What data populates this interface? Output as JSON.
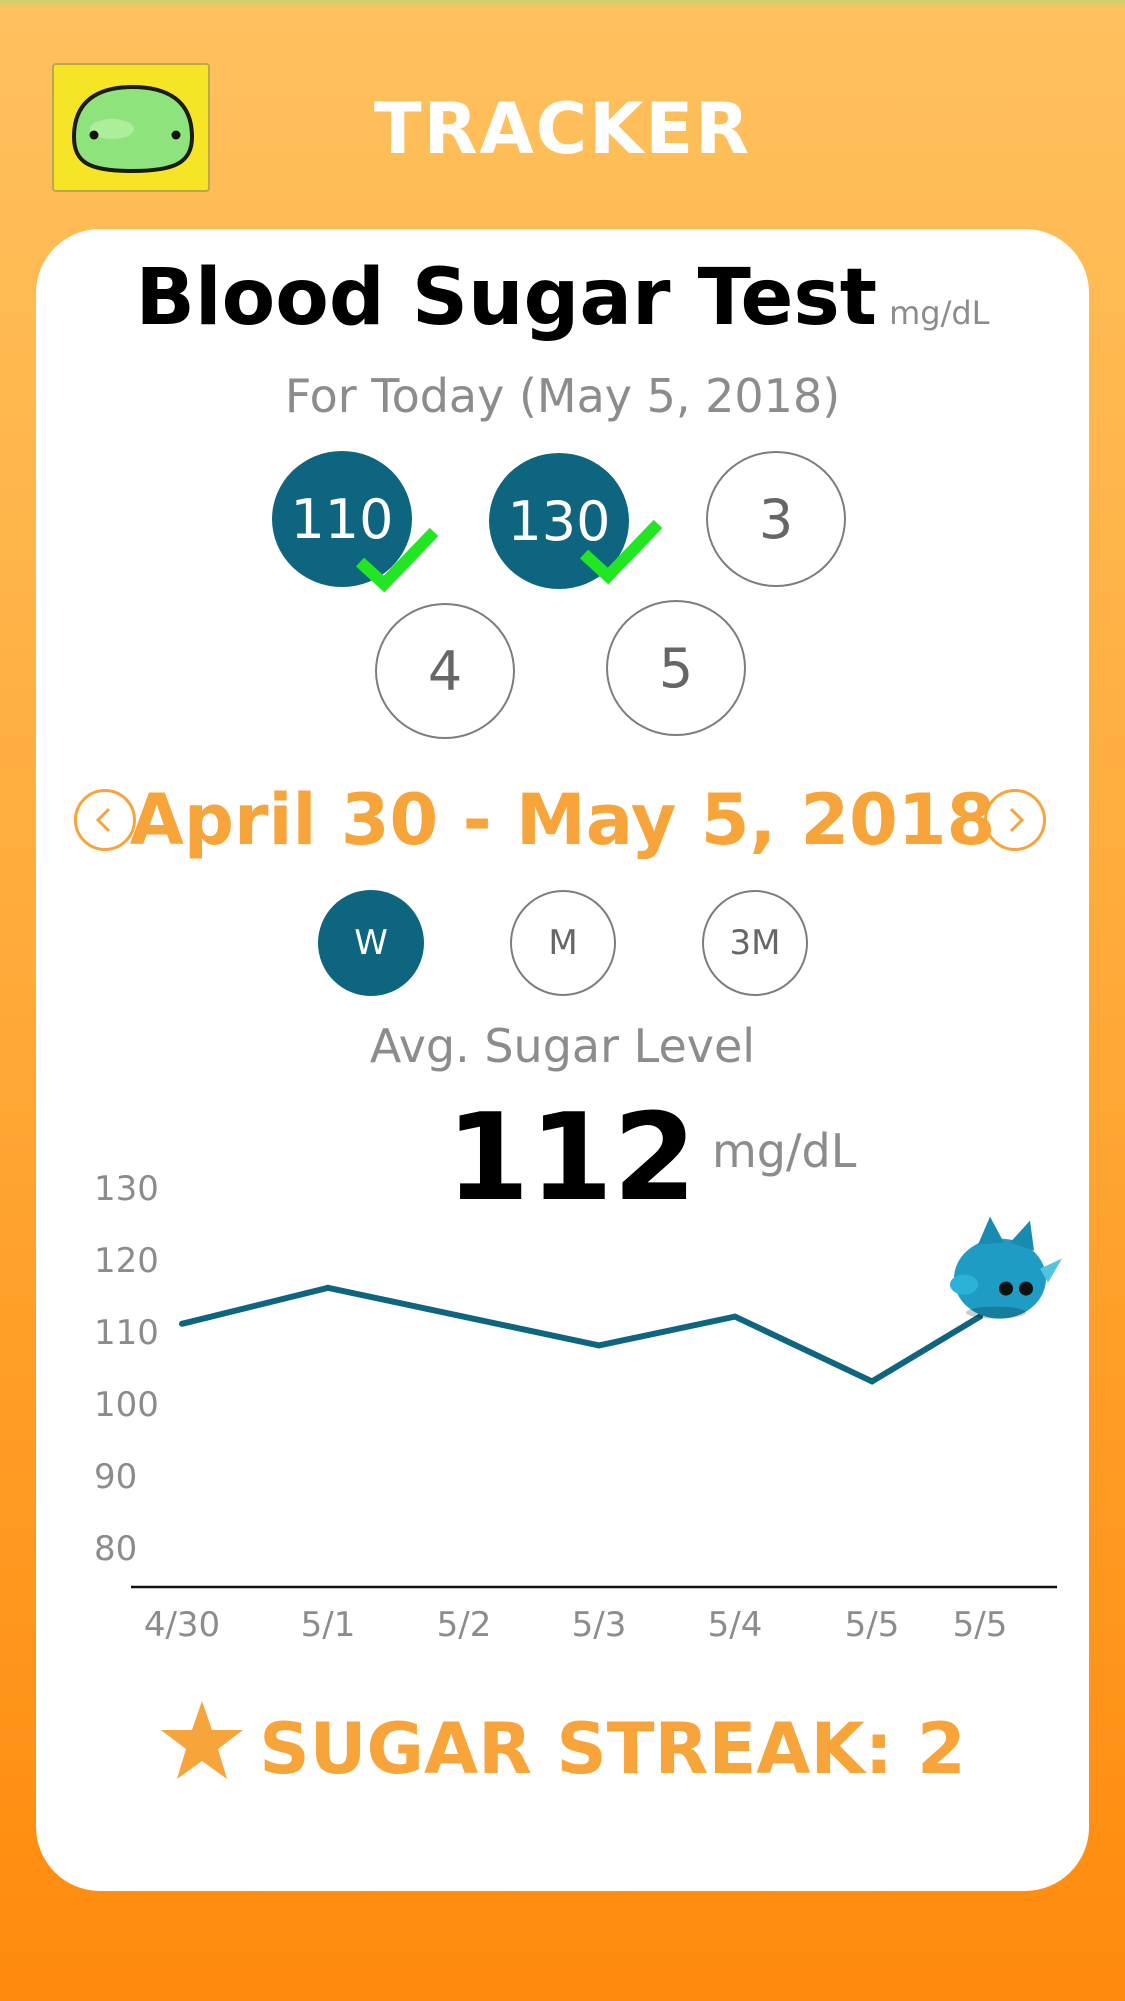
{
  "header": {
    "title": "TRACKER",
    "avatar_icon": "green-blob-icon"
  },
  "card": {
    "title": "Blood Sugar Test",
    "unit": "mg/dL",
    "today_label": "For Today (May 5, 2018)"
  },
  "readings": [
    {
      "label": "110",
      "done": true
    },
    {
      "label": "130",
      "done": true
    },
    {
      "label": "3",
      "done": false
    },
    {
      "label": "4",
      "done": false
    },
    {
      "label": "5",
      "done": false
    }
  ],
  "range": {
    "text": "April 30 - May 5, 2018",
    "prev_icon": "chevron-left-icon",
    "next_icon": "chevron-right-icon"
  },
  "periods": [
    {
      "label": "W",
      "selected": true
    },
    {
      "label": "M",
      "selected": false
    },
    {
      "label": "3M",
      "selected": false
    }
  ],
  "average": {
    "label": "Avg. Sugar Level",
    "value": "112",
    "unit": "mg/dL"
  },
  "chart_data": {
    "type": "line",
    "categories": [
      "4/30",
      "5/1",
      "5/2",
      "5/3",
      "5/4",
      "5/5",
      "5/5"
    ],
    "values": [
      111,
      116,
      null,
      108,
      112,
      103,
      112
    ],
    "yticks": [
      80,
      90,
      100,
      110,
      120,
      130
    ],
    "ylim": [
      80,
      130
    ],
    "grid": false,
    "line_color": "#0d6580",
    "marker_icon": "blue-bird-mascot-icon"
  },
  "streak": {
    "label": "SUGAR STREAK: 2",
    "icon": "star-icon"
  },
  "colors": {
    "accent_orange": "#f7a43a",
    "teal": "#0d6580",
    "check_green": "#22e622"
  }
}
